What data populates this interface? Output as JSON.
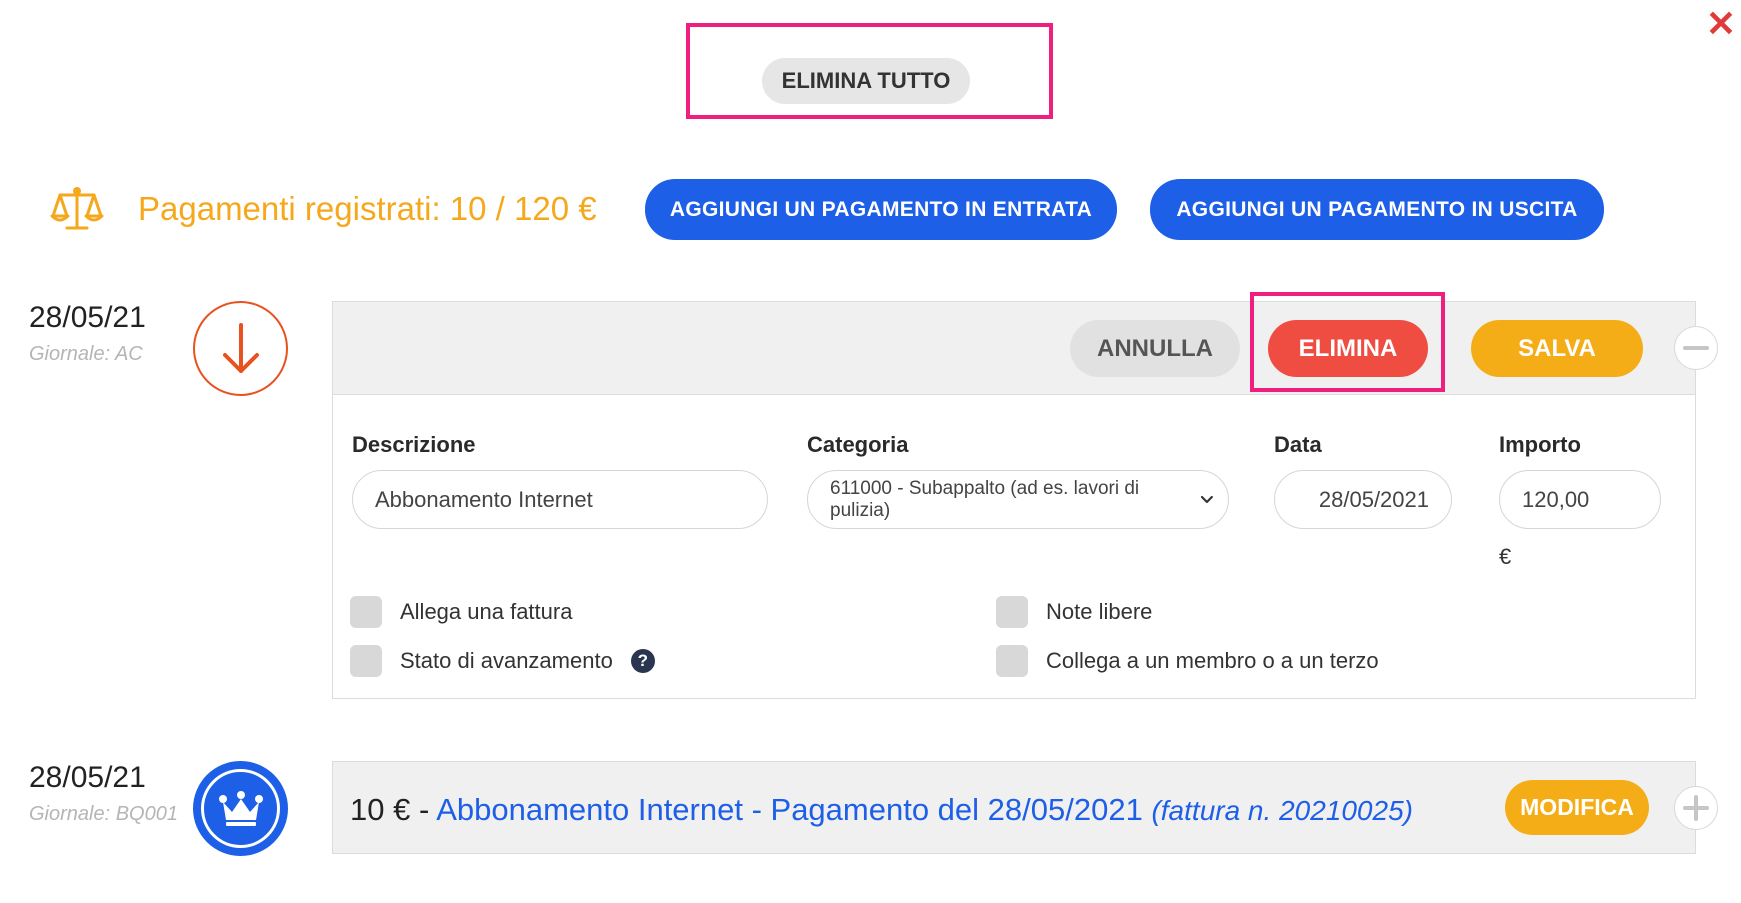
{
  "top": {
    "delete_all_label": "ELIMINA TUTTO",
    "close_glyph": "✕"
  },
  "summary": {
    "text": "Pagamenti registrati: 10 / 120 €",
    "add_income_label": "AGGIUNGI UN PAGAMENTO IN ENTRATA",
    "add_expense_label": "AGGIUNGI UN PAGAMENTO IN USCITA",
    "accent_color": "#f5a81c",
    "icon": "scale-icon"
  },
  "entries": [
    {
      "date": "28/05/21",
      "journal": "Giornale: AC",
      "icon": "arrow-down-icon",
      "buttons": {
        "cancel": "ANNULLA",
        "delete": "ELIMINA",
        "save": "SALVA"
      },
      "form": {
        "description_label": "Descrizione",
        "description_value": "Abbonamento Internet",
        "category_label": "Categoria",
        "category_value": "611000 - Subappalto (ad es. lavori di pulizia)",
        "date_label": "Data",
        "date_value": "28/05/2021",
        "amount_label": "Importo",
        "amount_value": "120,00",
        "currency": "€"
      },
      "options": {
        "attach_invoice": "Allega una fattura",
        "progress_state": "Stato di avanzamento",
        "free_notes": "Note libere",
        "link_member": "Collega a un membro o a un terzo"
      }
    },
    {
      "date": "28/05/21",
      "journal": "Giornale: BQ001",
      "icon": "crown-icon",
      "amount": "10 €",
      "separator": " - ",
      "link_text": "Abbonamento Internet - Pagamento del 28/05/2021",
      "invoice": "(fattura n. 20210025)",
      "edit_label": "MODIFICA"
    }
  ],
  "colors": {
    "primary_blue": "#1d5fe6",
    "danger_red": "#ef4c42",
    "warning_orange": "#f4ad17",
    "highlight_pink": "#ee1f7f"
  }
}
